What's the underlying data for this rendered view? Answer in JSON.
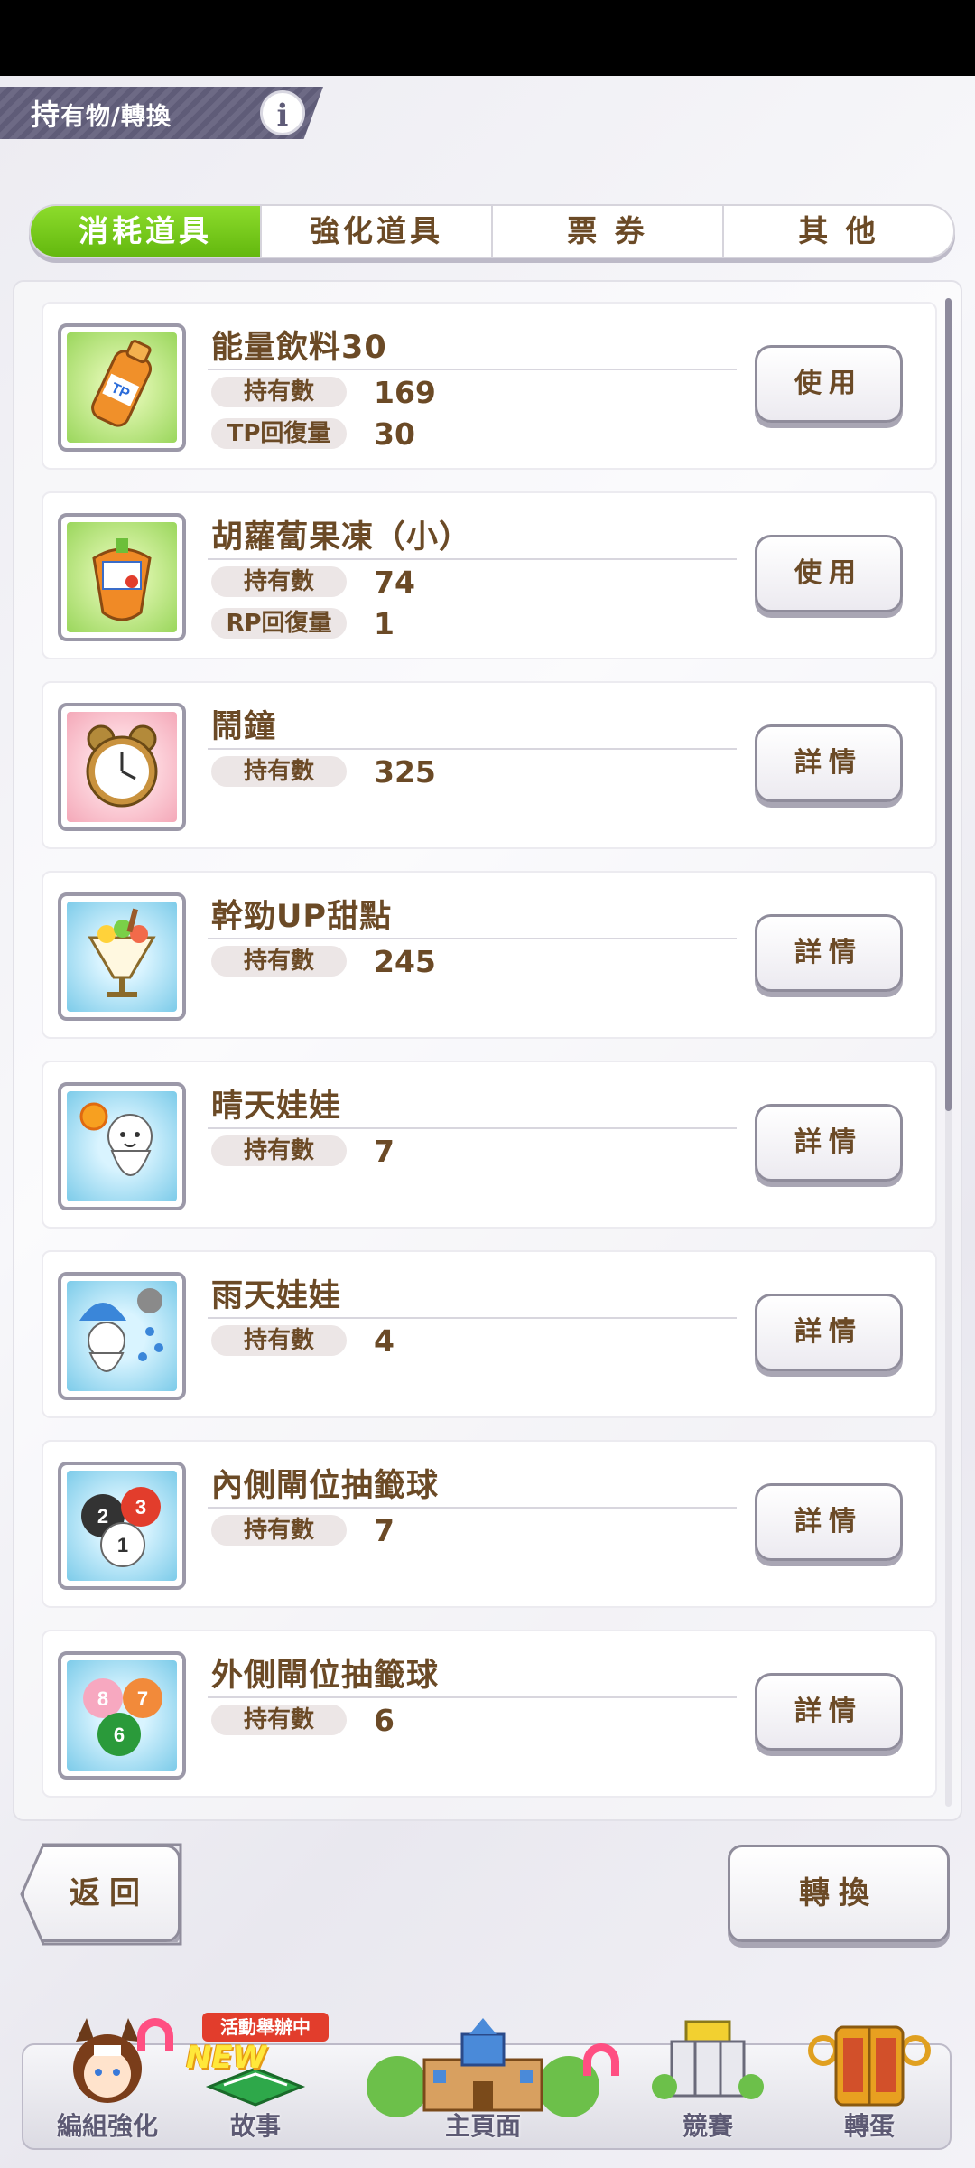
{
  "header": {
    "title_main": "持",
    "title_rest": "有物/轉換"
  },
  "tabs": [
    {
      "label": "消耗道具",
      "active": true
    },
    {
      "label": "強化道具",
      "active": false
    },
    {
      "label": "票 券",
      "active": false
    },
    {
      "label": "其 他",
      "active": false
    }
  ],
  "items": [
    {
      "name": "能量飲料30",
      "count_label": "持有數",
      "count": "169",
      "extra_label": "TP回復量",
      "extra_value": "30",
      "button": "使用",
      "icon": "tp-drink-icon"
    },
    {
      "name": "胡蘿蔔果凍（小）",
      "count_label": "持有數",
      "count": "74",
      "extra_label": "RP回復量",
      "extra_value": "1",
      "button": "使用",
      "icon": "carrot-jelly-icon"
    },
    {
      "name": "鬧鐘",
      "count_label": "持有數",
      "count": "325",
      "button": "詳情",
      "icon": "alarm-clock-icon"
    },
    {
      "name": "幹勁UP甜點",
      "count_label": "持有數",
      "count": "245",
      "button": "詳情",
      "icon": "parfait-icon"
    },
    {
      "name": "晴天娃娃",
      "count_label": "持有數",
      "count": "7",
      "button": "詳情",
      "icon": "sunny-doll-icon"
    },
    {
      "name": "雨天娃娃",
      "count_label": "持有數",
      "count": "4",
      "button": "詳情",
      "icon": "rainy-doll-icon"
    },
    {
      "name": "內側閘位抽籤球",
      "count_label": "持有數",
      "count": "7",
      "button": "詳情",
      "icon": "inner-gate-ball-icon"
    },
    {
      "name": "外側閘位抽籤球",
      "count_label": "持有數",
      "count": "6",
      "button": "詳情",
      "icon": "outer-gate-ball-icon"
    }
  ],
  "actions": {
    "back": "返回",
    "convert": "轉換"
  },
  "nav": {
    "event_badge": "活動舉辦中",
    "new_badge": "NEW",
    "items": [
      {
        "label": "編組強化"
      },
      {
        "label": "故事"
      },
      {
        "label": "主頁面"
      },
      {
        "label": "競賽"
      },
      {
        "label": "轉蛋"
      }
    ]
  },
  "colors": {
    "tab_active": "#63b80e",
    "text_brown": "#6b4a26",
    "header_bg": "#5f5c78"
  }
}
